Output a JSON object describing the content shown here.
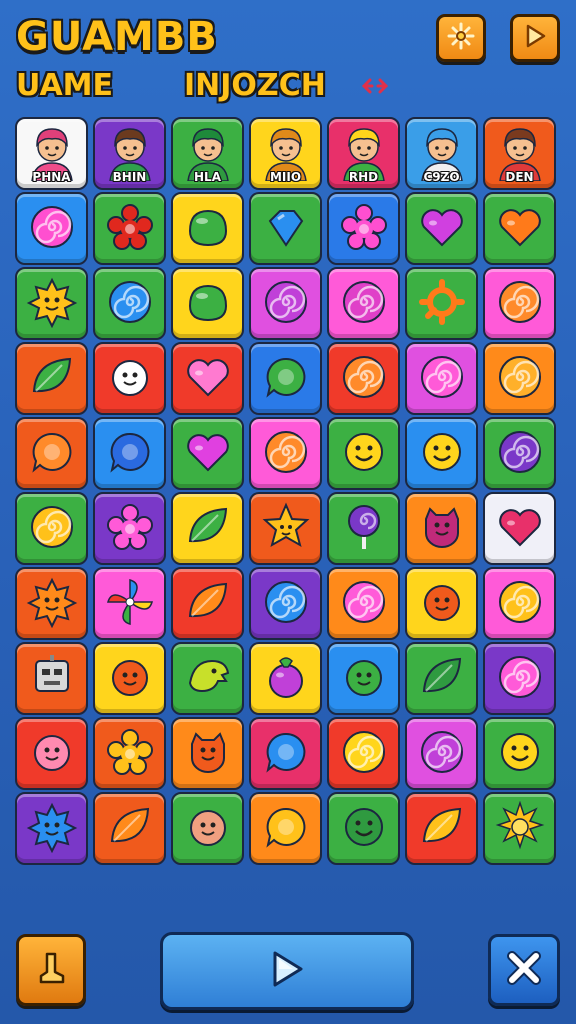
{
  "header": {
    "title": "GUAMBB",
    "subtitle_left": "UAME",
    "subtitle_right": "INJOZCH",
    "link_icon": "link-icon",
    "settings_icon": "sparkle-icon",
    "play_icon": "play-icon"
  },
  "characters": [
    {
      "name": "PHNA",
      "color": "#f8f8f8",
      "hair": "#e0407a",
      "shirt": "#ee4d8a"
    },
    {
      "name": "BHIN",
      "color": "#7a38c8",
      "hair": "#6b3a1e",
      "shirt": "#2fa24c"
    },
    {
      "name": "HLA",
      "color": "#3cb043",
      "hair": "#1e8a3a",
      "shirt": "#2f9a40"
    },
    {
      "name": "MIIO",
      "color": "#ffd51c",
      "hair": "#e08a1a",
      "shirt": "#e08a1a"
    },
    {
      "name": "RHD",
      "color": "#e8306a",
      "hair": "#ffd51c",
      "shirt": "#3cb043"
    },
    {
      "name": "C9ZO",
      "color": "#3a9ee8",
      "hair": "#3a9ee8",
      "shirt": "#f0f0f0"
    },
    {
      "name": "DEN",
      "color": "#f05a1c",
      "hair": "#7a3a1e",
      "shirt": "#e03a3a"
    }
  ],
  "board": [
    [
      {
        "bg": "#2a8ff0",
        "icon": "swirl",
        "c": "#ff4fd0"
      },
      {
        "bg": "#3cb043",
        "icon": "flower",
        "c": "#e0281e"
      },
      {
        "bg": "#ffd51c",
        "icon": "blob",
        "c": "#3cb043"
      },
      {
        "bg": "#3cb043",
        "icon": "gem",
        "c": "#2a8ff0"
      },
      {
        "bg": "#2a7ae8",
        "icon": "flower",
        "c": "#ff4fd0"
      },
      {
        "bg": "#3cb043",
        "icon": "heart",
        "c": "#d040e0"
      },
      {
        "bg": "#3cb043",
        "icon": "heart",
        "c": "#ff7a1a"
      }
    ],
    [
      {
        "bg": "#3cb043",
        "icon": "sun-face",
        "c": "#ffc11a"
      },
      {
        "bg": "#3cb043",
        "icon": "swirl",
        "c": "#2a8ff0"
      },
      {
        "bg": "#ffd51c",
        "icon": "blob",
        "c": "#3cb043"
      },
      {
        "bg": "#e050e0",
        "icon": "swirl",
        "c": "#c040d8"
      },
      {
        "bg": "#ff5ad8",
        "icon": "swirl",
        "c": "#e040c8"
      },
      {
        "bg": "#3cb043",
        "icon": "gear",
        "c": "#ff7a1a"
      },
      {
        "bg": "#ff5ad8",
        "icon": "swirl",
        "c": "#ff8a2a"
      }
    ],
    [
      {
        "bg": "#f05a1c",
        "icon": "leaf",
        "c": "#3cb043"
      },
      {
        "bg": "#f03a2a",
        "icon": "face",
        "c": "#ffffff"
      },
      {
        "bg": "#f03a2a",
        "icon": "heart",
        "c": "#ff7ad0"
      },
      {
        "bg": "#2a7ae8",
        "icon": "bubble",
        "c": "#3cb043"
      },
      {
        "bg": "#f03a2a",
        "icon": "swirl",
        "c": "#ff8a2a"
      },
      {
        "bg": "#e050e0",
        "icon": "swirl",
        "c": "#ff5ad8"
      },
      {
        "bg": "#ff8a1a",
        "icon": "swirl",
        "c": "#ffb02a"
      }
    ],
    [
      {
        "bg": "#f05a1c",
        "icon": "bubble",
        "c": "#ff8a2a"
      },
      {
        "bg": "#2a8ff0",
        "icon": "bubble",
        "c": "#2a6ae0"
      },
      {
        "bg": "#3cb043",
        "icon": "heart",
        "c": "#e040e0"
      },
      {
        "bg": "#ff5ad8",
        "icon": "swirl",
        "c": "#ff8a2a"
      },
      {
        "bg": "#3cb043",
        "icon": "smiley",
        "c": "#ffd51c"
      },
      {
        "bg": "#2a8ff0",
        "icon": "smiley",
        "c": "#ffd51c"
      },
      {
        "bg": "#3cb043",
        "icon": "swirl",
        "c": "#7a38c8"
      }
    ],
    [
      {
        "bg": "#3cb043",
        "icon": "swirl",
        "c": "#ffc11a"
      },
      {
        "bg": "#7a38c8",
        "icon": "flower",
        "c": "#ff5ad8"
      },
      {
        "bg": "#ffd51c",
        "icon": "leaf",
        "c": "#3cb043"
      },
      {
        "bg": "#f05a1c",
        "icon": "star",
        "c": "#ffc11a"
      },
      {
        "bg": "#3cb043",
        "icon": "lollipop",
        "c": "#7a38c8"
      },
      {
        "bg": "#ff8a1a",
        "icon": "monster",
        "c": "#c02a7a"
      },
      {
        "bg": "#f0f0f8",
        "icon": "heart",
        "c": "#e8306a"
      }
    ],
    [
      {
        "bg": "#f05a1c",
        "icon": "sun-face",
        "c": "#ff8a1a"
      },
      {
        "bg": "#ff5ad8",
        "icon": "pinwheel",
        "c": "#2a8ff0"
      },
      {
        "bg": "#f03a2a",
        "icon": "leaf",
        "c": "#ff8a1a"
      },
      {
        "bg": "#7a38c8",
        "icon": "swirl",
        "c": "#2a8ff0"
      },
      {
        "bg": "#ff8a1a",
        "icon": "swirl",
        "c": "#ff5ad8"
      },
      {
        "bg": "#ffd51c",
        "icon": "face",
        "c": "#f05a1c"
      },
      {
        "bg": "#ff5ad8",
        "icon": "swirl",
        "c": "#ffc11a"
      }
    ],
    [
      {
        "bg": "#f05a1c",
        "icon": "robot",
        "c": "#d8d8d8"
      },
      {
        "bg": "#ffd51c",
        "icon": "face",
        "c": "#f05a1c"
      },
      {
        "bg": "#3cb043",
        "icon": "dragon",
        "c": "#c8e02a"
      },
      {
        "bg": "#ffd51c",
        "icon": "berry",
        "c": "#c040d8"
      },
      {
        "bg": "#2a8ff0",
        "icon": "face",
        "c": "#3cb043"
      },
      {
        "bg": "#3cb043",
        "icon": "leaf",
        "c": "#2f9a40"
      },
      {
        "bg": "#7a38c8",
        "icon": "swirl",
        "c": "#ff5ad8"
      }
    ],
    [
      {
        "bg": "#f03a2a",
        "icon": "face",
        "c": "#ff8ab0"
      },
      {
        "bg": "#f05a1c",
        "icon": "flower",
        "c": "#ffc11a"
      },
      {
        "bg": "#ff8a1a",
        "icon": "monster",
        "c": "#f05a1c"
      },
      {
        "bg": "#e8306a",
        "icon": "bubble",
        "c": "#2a8ff0"
      },
      {
        "bg": "#f03a2a",
        "icon": "swirl",
        "c": "#ffd51c"
      },
      {
        "bg": "#e050e0",
        "icon": "swirl",
        "c": "#c040d8"
      },
      {
        "bg": "#3cb043",
        "icon": "smiley",
        "c": "#ffd51c"
      }
    ],
    [
      {
        "bg": "#7a38c8",
        "icon": "sun-face",
        "c": "#2a8ff0"
      },
      {
        "bg": "#f05a1c",
        "icon": "leaf",
        "c": "#ff8a1a"
      },
      {
        "bg": "#3cb043",
        "icon": "face",
        "c": "#f0a080"
      },
      {
        "bg": "#ff8a1a",
        "icon": "bubble",
        "c": "#ffc11a"
      },
      {
        "bg": "#3cb043",
        "icon": "smiley",
        "c": "#2f9a40"
      },
      {
        "bg": "#f03a2a",
        "icon": "leaf",
        "c": "#ffc11a"
      },
      {
        "bg": "#3cb043",
        "icon": "sun",
        "c": "#ffc11a"
      }
    ]
  ],
  "footer": {
    "left_icon": "boot-icon",
    "play_icon": "play-icon",
    "close_icon": "close-icon"
  }
}
